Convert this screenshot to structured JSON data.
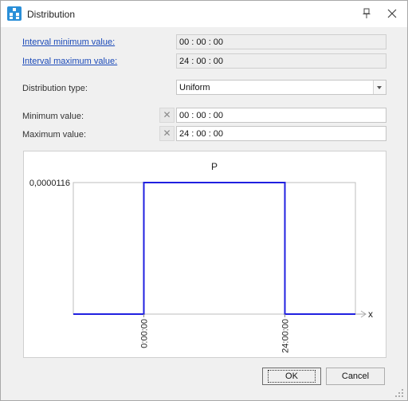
{
  "window": {
    "title": "Distribution"
  },
  "interval": {
    "min_label": "Interval minimum value:",
    "min_value": "00 : 00 : 00",
    "max_label": "Interval maximum value:",
    "max_value": "24 : 00 : 00"
  },
  "distribution": {
    "type_label": "Distribution type:",
    "type_value": "Uniform"
  },
  "params": {
    "min_label": "Minimum value:",
    "min_value": "00 : 00 : 00",
    "max_label": "Maximum value:",
    "max_value": "24 : 00 : 00",
    "clear_symbol": "✕"
  },
  "chart_data": {
    "type": "line",
    "title": "P",
    "xlabel": "x",
    "ylabel": "",
    "y_tick_labels": [
      "0,0000116"
    ],
    "x_tick_labels": [
      "0:00:00",
      "24:00:00"
    ],
    "x_hours": [
      0,
      0,
      24,
      24
    ],
    "y": [
      0,
      1.16e-05,
      1.16e-05,
      0
    ],
    "line_color": "#2020e0"
  },
  "buttons": {
    "ok": "OK",
    "cancel": "Cancel"
  }
}
